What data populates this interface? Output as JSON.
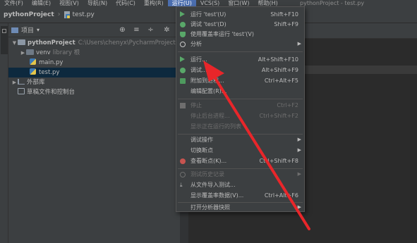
{
  "menubar": {
    "items": [
      "文件(F)",
      "编辑(E)",
      "视图(V)",
      "导航(N)",
      "代码(C)",
      "重构(R)",
      "运行(U)",
      "VCS(S)",
      "窗口(W)",
      "帮助(H)"
    ],
    "active_index": 6,
    "window_title": "pythonProject - test.py"
  },
  "navbar": {
    "project": "pythonProject",
    "file": "test.py"
  },
  "project_panel": {
    "title": "项目",
    "tree": {
      "root": "pythonProject",
      "root_path": "C:\\Users\\chenyx\\PycharmProject",
      "venv": "venv",
      "venv_hint": "library 根",
      "main": "main.py",
      "test": "test.py",
      "ext_libs": "外部库",
      "scratches": "草稿文件和控制台"
    }
  },
  "run_menu": {
    "items": [
      {
        "label": "运行 'test'(U)",
        "shortcut": "Shift+F10"
      },
      {
        "label": "调试 'test'(D)",
        "shortcut": "Shift+F9"
      },
      {
        "label": "使用覆盖率运行 'test'(V)",
        "shortcut": ""
      },
      {
        "label": "分析",
        "shortcut": ""
      },
      {
        "label": "运行...",
        "shortcut": "Alt+Shift+F10"
      },
      {
        "label": "调试...",
        "shortcut": "Alt+Shift+F9"
      },
      {
        "label": "附加到进程...",
        "shortcut": "Ctrl+Alt+F5"
      },
      {
        "label": "编辑配置(R)...",
        "shortcut": ""
      },
      {
        "label": "停止",
        "shortcut": "Ctrl+F2"
      },
      {
        "label": "停止后台进程...",
        "shortcut": "Ctrl+Shift+F2"
      },
      {
        "label": "显示正在运行的列表",
        "shortcut": ""
      },
      {
        "label": "调试操作",
        "shortcut": ""
      },
      {
        "label": "切换断点",
        "shortcut": ""
      },
      {
        "label": "查看断点(K)...",
        "shortcut": "Ctrl+Shift+F8"
      },
      {
        "label": "测试历史记录",
        "shortcut": ""
      },
      {
        "label": "从文件导入测试...",
        "shortcut": ""
      },
      {
        "label": "显示覆盖率数据(V)...",
        "shortcut": "Ctrl+Alt+F6"
      },
      {
        "label": "打开分析器快照",
        "shortcut": ""
      }
    ]
  },
  "colors": {
    "highlight": "#4b6eaf",
    "run_green": "#59a869",
    "annotation_red": "#e8262a",
    "selection": "#0d293e"
  }
}
